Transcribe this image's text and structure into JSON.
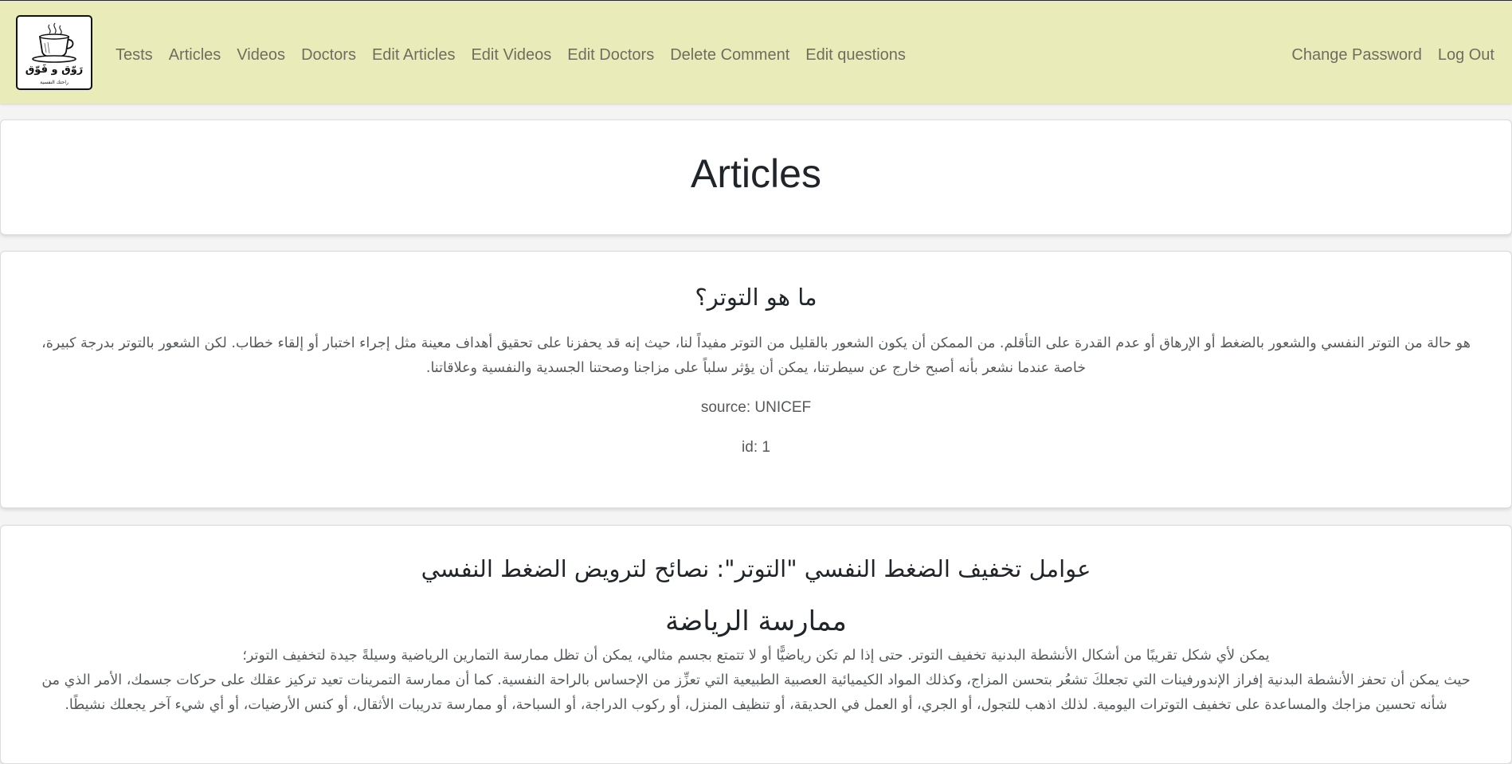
{
  "logo": {
    "title": "رَوّق و فَوّق",
    "subtitle": "راحتك النفسية"
  },
  "nav": {
    "left": [
      "Tests",
      "Articles",
      "Videos",
      "Doctors",
      "Edit Articles",
      "Edit Videos",
      "Edit Doctors",
      "Delete Comment",
      "Edit questions"
    ],
    "right": [
      "Change Password",
      "Log Out"
    ]
  },
  "page": {
    "title": "Articles"
  },
  "articles": [
    {
      "title": "ما هو التوتر؟",
      "body": "هو حالة من التوتر النفسي والشعور بالضغط أو الإرهاق أو عدم القدرة على التأقلم. من الممكن أن يكون الشعور بالقليل من التوتر مفيداً لنا، حيث إنه قد يحفزنا على تحقيق أهداف معينة مثل إجراء اختبار أو إلقاء خطاب. لكن الشعور بالتوتر بدرجة كبيرة، خاصة عندما نشعر بأنه أصبح خارج عن سيطرتنا، يمكن أن يؤثر سلباً على مزاجنا وصحتنا الجسدية والنفسية وعلاقاتنا.",
      "source": "source: UNICEF",
      "id": "id: 1"
    },
    {
      "title": "عوامل تخفيف الضغط النفسي \"التوتر\": نصائح لترويض الضغط النفسي",
      "subtitle": "ممارسة الرياضة",
      "line1": "يمكن لأي شكل تقريبًا من أشكال الأنشطة البدنية تخفيف التوتر. حتى إذا لم تكن رياضيًّا أو لا تتمتع بجسم مثالي، يمكن أن تظل ممارسة التمارين الرياضية وسيلةً جيدة لتخفيف التوتر؛",
      "line2": "حيث يمكن أن تحفز الأنشطة البدنية إفراز الإندورفينات التي تجعلكَ تشعُر بتحسن المزاج، وكذلك المواد الكيميائية العصبية الطبيعية التي تعزِّز من الإحساس بالراحة النفسية. كما أن ممارسة التمرينات تعيد تركيز عقلك على حركات جسمك، الأمر الذي من شأنه تحسين مزاجك والمساعدة على تخفيف التوترات اليومية. لذلك اذهب للتجول، أو الجري، أو العمل في الحديقة، أو تنظيف المنزل، أو ركوب الدراجة، أو السباحة، أو ممارسة تدريبات الأثقال، أو كنس الأرضيات، أو أي شيء آخر يجعلك نشيطًا."
    }
  ]
}
